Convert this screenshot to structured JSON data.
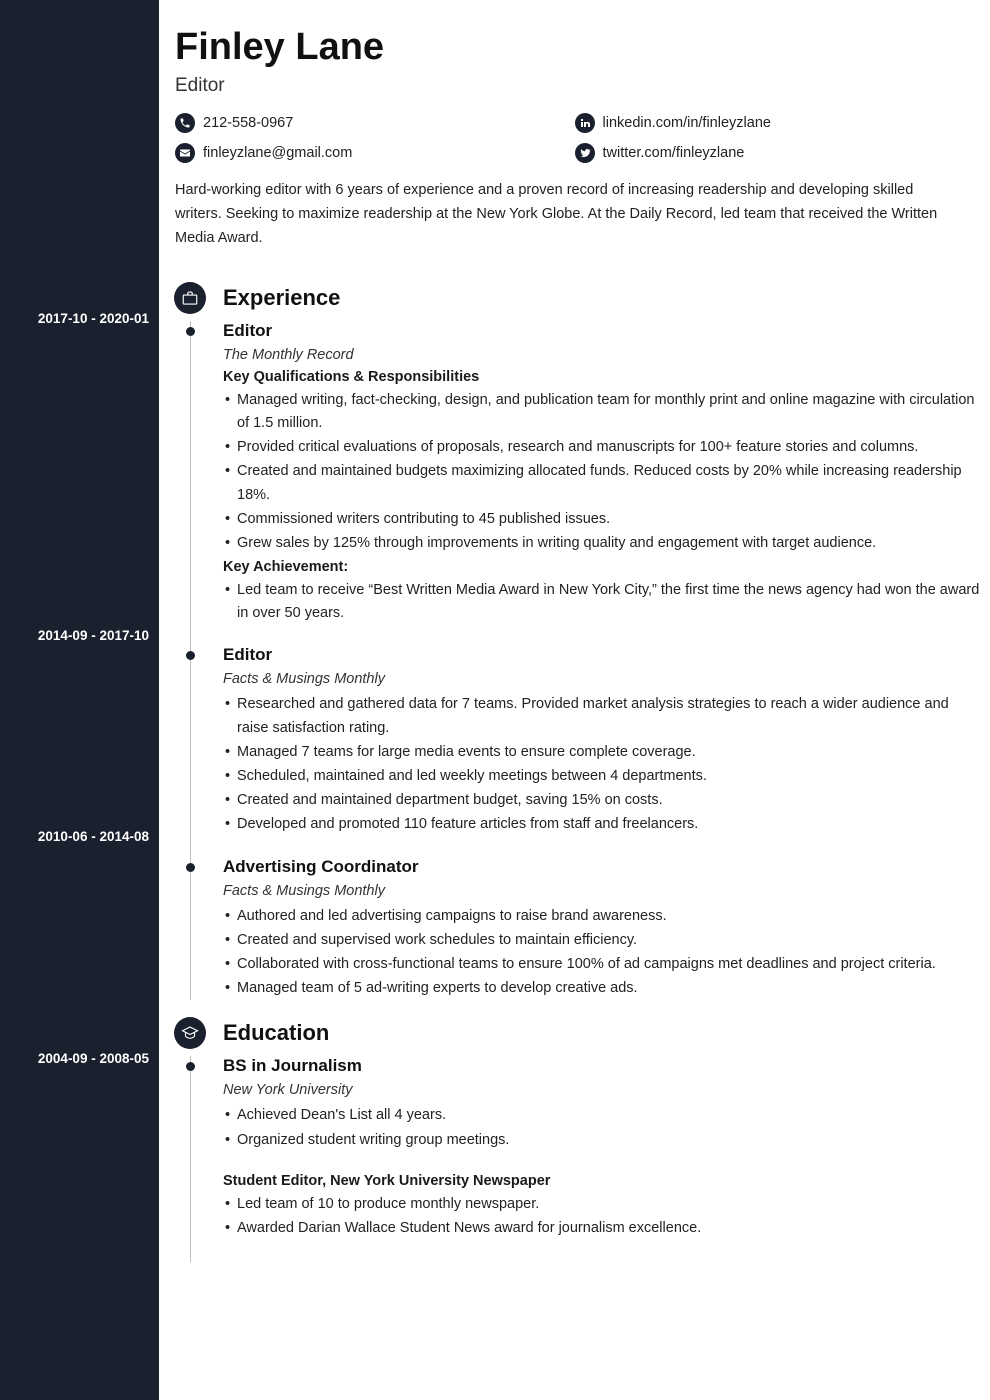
{
  "header": {
    "name": "Finley Lane",
    "title": "Editor"
  },
  "contacts": {
    "phone": "212-558-0967",
    "email": "finleyzlane@gmail.com",
    "linkedin": "linkedin.com/in/finleyzlane",
    "twitter": "twitter.com/finleyzlane"
  },
  "summary": "Hard-working editor with 6 years of experience and a proven record of increasing readership and developing skilled writers. Seeking to maximize readership at the New York Globe. At the Daily Record, led team that received the Written Media Award.",
  "sections": {
    "experience_title": "Experience",
    "education_title": "Education"
  },
  "experience": [
    {
      "dates": "2017-10 - 2020-01",
      "title": "Editor",
      "org": "The Monthly Record",
      "subhead1": "Key Qualifications & Responsibilities",
      "bullets1": [
        "Managed writing, fact-checking, design, and publication team for monthly print and online magazine with circulation of 1.5 million.",
        "Provided critical evaluations of proposals, research and manuscripts for 100+ feature stories and columns.",
        "Created and maintained budgets maximizing allocated funds. Reduced costs by 20% while increasing readership 18%.",
        "Commissioned writers contributing to 45 published issues.",
        "Grew sales by 125% through improvements in writing quality and engagement with target audience."
      ],
      "subhead2": "Key Achievement:",
      "bullets2": [
        "Led team to receive “Best Written Media Award in New York City,” the first time the news agency had won the award in over 50 years."
      ]
    },
    {
      "dates": "2014-09 - 2017-10",
      "title": "Editor",
      "org": "Facts & Musings Monthly",
      "bullets1": [
        "Researched and gathered data for 7 teams. Provided market analysis strategies to reach a wider audience and raise satisfaction rating.",
        "Managed 7 teams for large media events to ensure complete coverage.",
        "Scheduled, maintained and led weekly meetings between 4 departments.",
        "Created and maintained department budget, saving 15% on costs.",
        "Developed and promoted 110 feature articles from staff and freelancers."
      ]
    },
    {
      "dates": "2010-06 - 2014-08",
      "title": "Advertising Coordinator",
      "org": "Facts & Musings Monthly",
      "bullets1": [
        "Authored and led advertising campaigns to raise brand awareness.",
        "Created and supervised work schedules to maintain efficiency.",
        "Collaborated with cross-functional teams to ensure 100% of ad campaigns met deadlines and project criteria.",
        "Managed team of 5 ad-writing experts to develop creative ads."
      ]
    }
  ],
  "education": [
    {
      "dates": "2004-09 - 2008-05",
      "title": "BS in Journalism",
      "org": "New York University",
      "bullets1": [
        "Achieved Dean's List all 4 years.",
        "Organized student writing group meetings."
      ],
      "subhead2": "Student Editor, New York University Newspaper",
      "bullets2": [
        "Led team of 10 to produce monthly newspaper.",
        "Awarded Darian Wallace Student News award for journalism excellence."
      ]
    }
  ]
}
